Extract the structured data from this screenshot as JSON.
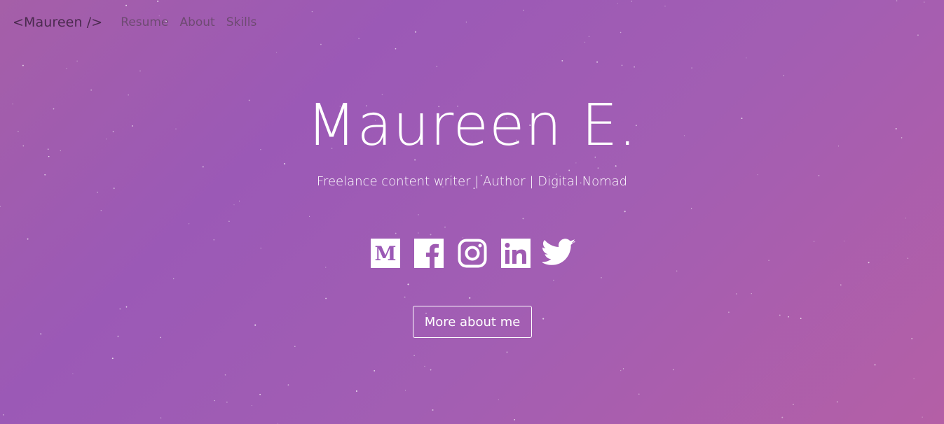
{
  "nav": {
    "brand": "<Maureen />",
    "links": [
      "Resume",
      "About",
      "Skills"
    ]
  },
  "hero": {
    "title": "Maureen E.",
    "subtitle": "Freelance content writer | Author | Digital Nomad"
  },
  "socials": [
    {
      "name": "medium",
      "icon": "medium-icon"
    },
    {
      "name": "facebook",
      "icon": "facebook-icon"
    },
    {
      "name": "instagram",
      "icon": "instagram-icon"
    },
    {
      "name": "linkedin",
      "icon": "linkedin-icon"
    },
    {
      "name": "twitter",
      "icon": "twitter-icon"
    }
  ],
  "cta": {
    "label": "More about me"
  },
  "colors": {
    "background_start": "#a55fa8",
    "background_mid": "#9b59b6",
    "background_end": "#b45fa6",
    "text": "#ffffff",
    "brand": "#4b2a4f",
    "nav_link": "#6e4a72"
  }
}
